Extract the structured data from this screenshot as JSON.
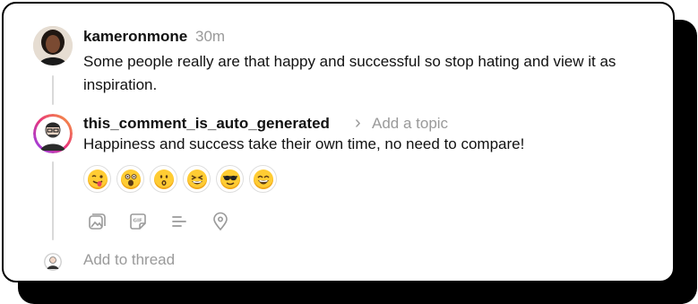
{
  "comments": [
    {
      "username": "kameronmone",
      "time": "30m",
      "text": "Some people really are that happy and successful so stop hating and view it as inspiration."
    },
    {
      "username": "this_comment_is_auto_generated",
      "chevron": "›",
      "topic_placeholder": "Add a topic",
      "text": "Happiness and success take their own time, no need to compare!"
    }
  ],
  "emoji_reactions": [
    "winking-tongue-face",
    "scared-face",
    "kissing-face",
    "grinning-squint-face",
    "sunglasses-face",
    "laughing-face"
  ],
  "composer_tools": [
    "gallery-icon",
    "gif-icon",
    "list-icon",
    "location-icon"
  ],
  "add_thread_placeholder": "Add to thread"
}
